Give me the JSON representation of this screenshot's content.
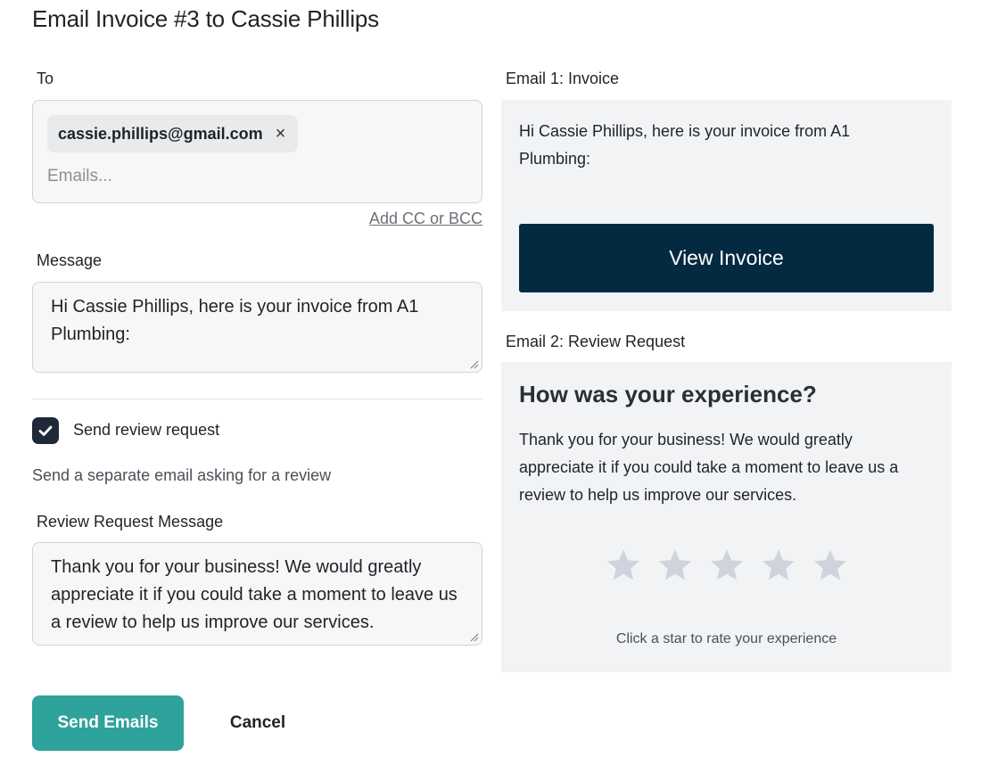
{
  "dialog": {
    "title": "Email Invoice #3 to Cassie Phillips"
  },
  "to": {
    "label": "To",
    "recipients": [
      "cassie.phillips@gmail.com"
    ],
    "remove_glyph": "×",
    "placeholder": "Emails...",
    "value": "",
    "add_cc_label": "Add CC or BCC"
  },
  "message": {
    "label": "Message",
    "value": "Hi Cassie Phillips, here is your invoice from A1 Plumbing:"
  },
  "review": {
    "checkbox_checked": true,
    "checkbox_label": "Send review request",
    "help_text": "Send a separate email asking for a review",
    "message_label": "Review Request Message",
    "message_value": "Thank you for your business! We would greatly appreciate it if you could take a moment to leave us a review to help us improve our services."
  },
  "actions": {
    "send_label": "Send Emails",
    "cancel_label": "Cancel"
  },
  "preview": {
    "email1_label": "Email 1: Invoice",
    "email1_body": "Hi Cassie Phillips, here is your invoice from A1 Plumbing:",
    "view_invoice_label": "View Invoice",
    "email2_label": "Email 2: Review Request",
    "review_heading": "How was your experience?",
    "review_body": "Thank you for your business! We would greatly appreciate it if you could take a moment to leave us a review to help us improve our services.",
    "stars_total": 5,
    "rating_selected": 0,
    "rate_hint": "Click a star to rate your experience"
  },
  "colors": {
    "send_button": "#2ea39b",
    "view_invoice_button": "#032a40",
    "checkbox": "#1f2937",
    "star_inactive": "#cfd4dc",
    "preview_bg": "#f2f3f5"
  },
  "icons": {
    "remove": "close-icon",
    "checkbox": "checkmark-icon",
    "star": "star-icon",
    "resize": "resize-grip-icon"
  }
}
